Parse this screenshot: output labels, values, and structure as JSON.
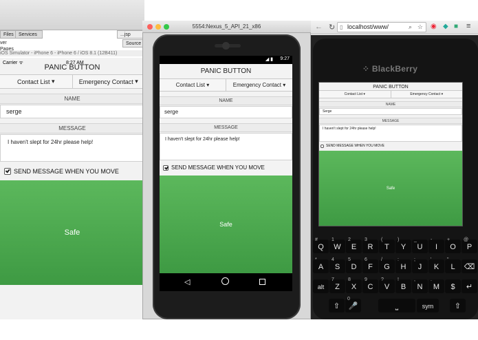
{
  "ide": {
    "tabs": [
      "Files",
      "Services",
      "...jsp"
    ],
    "source_tab": "Source",
    "side_text": [
      "ver",
      "Pages"
    ]
  },
  "ios": {
    "simulator_title": "iOS Simulator - iPhone 6 - iPhone 6 / iOS 8.1 (12B411)",
    "carrier": "Carrier",
    "time": "8:27 AM"
  },
  "android": {
    "window_title": "5554:Nexus_5_API_21_x86",
    "time": "9:27"
  },
  "browser": {
    "url": "localhost/www/"
  },
  "blackberry": {
    "brand": "BlackBerry",
    "keys_row1": [
      {
        "alt": "#",
        "k": "Q"
      },
      {
        "alt": "1",
        "k": "W"
      },
      {
        "alt": "2",
        "k": "E"
      },
      {
        "alt": "3",
        "k": "R"
      },
      {
        "alt": "(",
        "k": "T"
      },
      {
        "alt": ")",
        "k": "Y"
      },
      {
        "alt": "_",
        "k": "U"
      },
      {
        "alt": "-",
        "k": "I"
      },
      {
        "alt": "+",
        "k": "O"
      },
      {
        "alt": "@",
        "k": "P"
      }
    ],
    "keys_row2": [
      {
        "alt": "*",
        "k": "A"
      },
      {
        "alt": "4",
        "k": "S"
      },
      {
        "alt": "5",
        "k": "D"
      },
      {
        "alt": "6",
        "k": "F"
      },
      {
        "alt": "/",
        "k": "G"
      },
      {
        "alt": ":",
        "k": "H"
      },
      {
        "alt": ";",
        "k": "J"
      },
      {
        "alt": "'",
        "k": "K"
      },
      {
        "alt": "\"",
        "k": "L"
      },
      {
        "alt": "",
        "k": "⌫"
      }
    ],
    "keys_row3": [
      {
        "alt": "",
        "k": "alt"
      },
      {
        "alt": "7",
        "k": "Z"
      },
      {
        "alt": "8",
        "k": "X"
      },
      {
        "alt": "9",
        "k": "C"
      },
      {
        "alt": "?",
        "k": "V"
      },
      {
        "alt": "!",
        "k": "B"
      },
      {
        "alt": ",",
        "k": "N"
      },
      {
        "alt": ".",
        "k": "M"
      },
      {
        "alt": "",
        "k": "$"
      },
      {
        "alt": "",
        "k": "↵"
      }
    ],
    "keys_row4": [
      {
        "alt": "",
        "k": "⇧"
      },
      {
        "alt": "0",
        "k": "🎤"
      },
      {
        "alt": "",
        "k": "⎵"
      },
      {
        "alt": "",
        "k": "sym"
      },
      {
        "alt": "",
        "k": "⇧"
      }
    ]
  },
  "app": {
    "title": "PANIC BUTTON",
    "contact_list_button": "Contact List",
    "emergency_contact_button": "Emergency Contact",
    "name_label": "NAME",
    "name_value": "serge",
    "bb_name_value": "Serge",
    "message_label": "MESSAGE",
    "message_value": "I haven't slept for 24hr please help!",
    "move_checkbox_label": "SEND MESSAGE WHEN YOU MOVE",
    "safe_button": "Safe"
  },
  "colors": {
    "safe_green": "#4cae4c",
    "android_nav": "#000000"
  }
}
